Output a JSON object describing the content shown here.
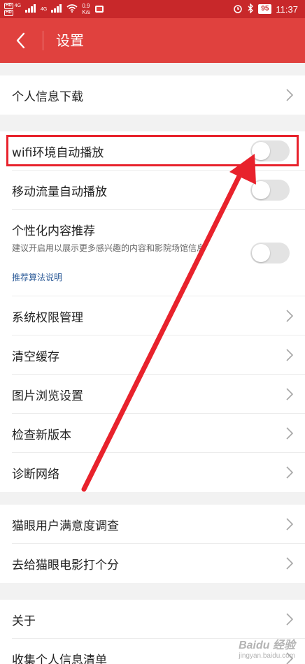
{
  "status_bar": {
    "hd_label": "HD",
    "signal_label": "4G",
    "net_speed_value": "0.9",
    "net_speed_unit": "K/s",
    "battery": "95",
    "time": "11:37"
  },
  "header": {
    "title": "设置"
  },
  "groups": {
    "g1": [
      {
        "label": "个人信息下载"
      }
    ],
    "g2": {
      "wifi_autoplay": "wifi环境自动播放",
      "mobile_autoplay": "移动流量自动播放",
      "personalized": {
        "title": "个性化内容推荐",
        "description": "建议开启用以展示更多感兴趣的内容和影院场馆信息",
        "link": "推荐算法说明"
      },
      "items": [
        {
          "label": "系统权限管理"
        },
        {
          "label": "清空缓存"
        },
        {
          "label": "图片浏览设置"
        },
        {
          "label": "检查新版本"
        },
        {
          "label": "诊断网络"
        }
      ]
    },
    "g3": [
      {
        "label": "猫眼用户满意度调查"
      },
      {
        "label": "去给猫眼电影打个分"
      }
    ],
    "g4": [
      {
        "label": "关于"
      },
      {
        "label": "收集个人信息清单"
      }
    ]
  },
  "toggles": {
    "wifi_autoplay": false,
    "mobile_autoplay": false,
    "personalized": false
  },
  "watermark": {
    "text": "Baidu 经验",
    "sub": "jingyan.baidu.com"
  },
  "colors": {
    "status_bar": "#c8282a",
    "header": "#e0413e",
    "annotation": "#e8222c",
    "link": "#2e5c99"
  },
  "icons": {
    "back": "chevron-left-icon",
    "chevron": "chevron-right-icon"
  }
}
